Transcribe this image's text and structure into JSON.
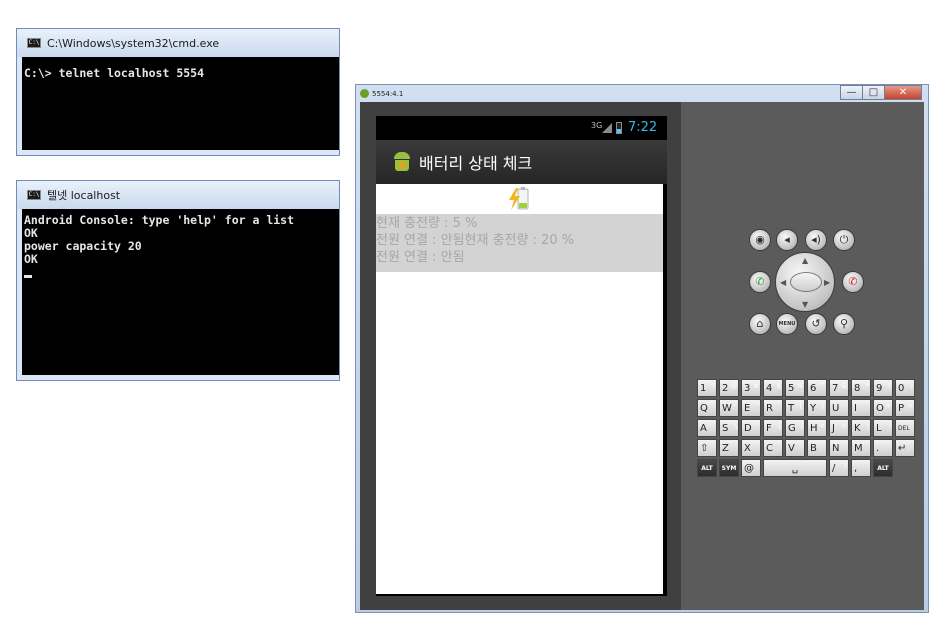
{
  "cmd_window": {
    "title": "C:\\Windows\\system32\\cmd.exe",
    "lines": [
      "C:\\> telnet localhost 5554"
    ]
  },
  "telnet_window": {
    "title": "텔넷 localhost",
    "lines": [
      "Android Console: type 'help' for a list",
      "OK",
      "power capacity 20",
      "OK"
    ]
  },
  "emulator": {
    "window_title": "5554:4.1",
    "window_buttons": {
      "minimize": "—",
      "maximize": "□",
      "close": "✕"
    },
    "statusbar": {
      "network": "3G",
      "time": "7:22"
    },
    "app_title": "배터리 상태 체크",
    "info_lines": [
      "현재 충전량 : 5 %",
      "전원 연결 : 안됨현재 충전량 : 20 %",
      "전원 연결 : 안됨"
    ],
    "buttons": {
      "camera": "camera-icon",
      "volume_down": "volume-down-icon",
      "volume_up": "volume-up-icon",
      "power": "power-icon",
      "call": "call-icon",
      "end_call": "end-call-icon",
      "home": "home-icon",
      "menu_label": "MENU",
      "back": "back-icon",
      "search": "search-icon"
    },
    "keyboard": {
      "rows": [
        [
          {
            "k": "1",
            "a": "!"
          },
          {
            "k": "2",
            "a": "@"
          },
          {
            "k": "3",
            "a": "#"
          },
          {
            "k": "4",
            "a": "$"
          },
          {
            "k": "5",
            "a": "%"
          },
          {
            "k": "6",
            "a": "^"
          },
          {
            "k": "7",
            "a": "&"
          },
          {
            "k": "8",
            "a": "*"
          },
          {
            "k": "9",
            "a": "("
          },
          {
            "k": "0",
            "a": ")"
          }
        ],
        [
          {
            "k": "Q",
            "a": ""
          },
          {
            "k": "W",
            "a": "~"
          },
          {
            "k": "E",
            "a": "\""
          },
          {
            "k": "R",
            "a": ""
          },
          {
            "k": "T",
            "a": "{"
          },
          {
            "k": "Y",
            "a": "}"
          },
          {
            "k": "U",
            "a": "-"
          },
          {
            "k": "I",
            "a": ""
          },
          {
            "k": "O",
            "a": "+"
          },
          {
            "k": "P",
            "a": "="
          }
        ],
        [
          {
            "k": "A",
            "a": ""
          },
          {
            "k": "S",
            "a": "\\"
          },
          {
            "k": "D",
            "a": "'"
          },
          {
            "k": "F",
            "a": "["
          },
          {
            "k": "G",
            "a": "]"
          },
          {
            "k": "H",
            "a": "<"
          },
          {
            "k": "J",
            "a": ">"
          },
          {
            "k": "K",
            "a": ";"
          },
          {
            "k": "L",
            "a": ":"
          },
          {
            "k": "DEL",
            "a": ""
          }
        ],
        [
          {
            "k": "⇧",
            "a": ""
          },
          {
            "k": "Z",
            "a": ""
          },
          {
            "k": "X",
            "a": ""
          },
          {
            "k": "C",
            "a": ""
          },
          {
            "k": "V",
            "a": ""
          },
          {
            "k": "B",
            "a": ""
          },
          {
            "k": "N",
            "a": ""
          },
          {
            "k": "M",
            "a": ""
          },
          {
            "k": ".",
            "a": ""
          },
          {
            "k": "↵",
            "a": ""
          }
        ],
        [
          {
            "k": "ALT",
            "a": ""
          },
          {
            "k": "SYM",
            "a": ""
          },
          {
            "k": "@",
            "a": ""
          },
          {
            "k": "␣",
            "a": ""
          },
          {
            "k": "/",
            "a": "?"
          },
          {
            "k": ",",
            "a": ""
          },
          {
            "k": "ALT",
            "a": ""
          }
        ]
      ]
    }
  }
}
